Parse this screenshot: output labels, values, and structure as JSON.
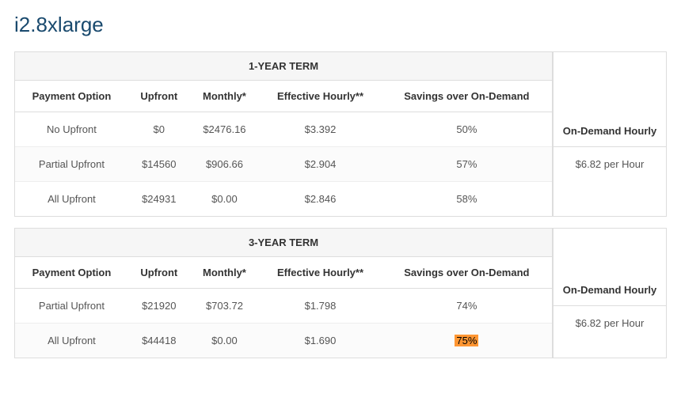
{
  "title": "i2.8xlarge",
  "headers": {
    "payment_option": "Payment Option",
    "upfront": "Upfront",
    "monthly": "Monthly*",
    "effective_hourly": "Effective Hourly**",
    "savings": "Savings over On-Demand",
    "on_demand_hourly": "On-Demand Hourly"
  },
  "on_demand_hourly": "$6.82 per Hour",
  "terms": [
    {
      "label": "1-YEAR TERM",
      "rows": [
        {
          "payment_option": "No Upfront",
          "upfront": "$0",
          "monthly": "$2476.16",
          "effective_hourly": "$3.392",
          "savings": "50%",
          "highlight": false
        },
        {
          "payment_option": "Partial Upfront",
          "upfront": "$14560",
          "monthly": "$906.66",
          "effective_hourly": "$2.904",
          "savings": "57%",
          "highlight": false
        },
        {
          "payment_option": "All Upfront",
          "upfront": "$24931",
          "monthly": "$0.00",
          "effective_hourly": "$2.846",
          "savings": "58%",
          "highlight": false
        }
      ]
    },
    {
      "label": "3-YEAR TERM",
      "rows": [
        {
          "payment_option": "Partial Upfront",
          "upfront": "$21920",
          "monthly": "$703.72",
          "effective_hourly": "$1.798",
          "savings": "74%",
          "highlight": false
        },
        {
          "payment_option": "All Upfront",
          "upfront": "$44418",
          "monthly": "$0.00",
          "effective_hourly": "$1.690",
          "savings": "75%",
          "highlight": true
        }
      ]
    }
  ]
}
